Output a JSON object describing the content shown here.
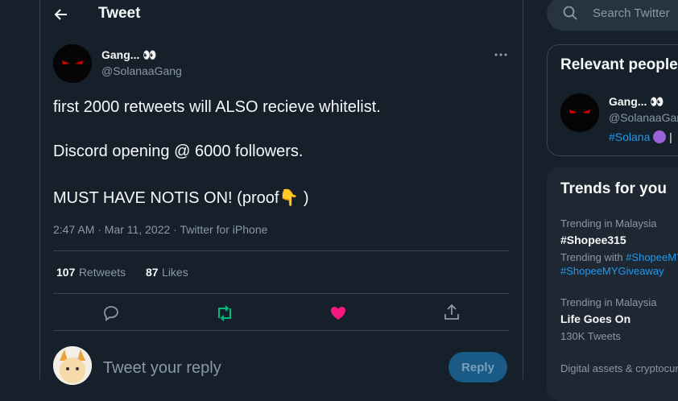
{
  "header": {
    "title": "Tweet"
  },
  "tweet": {
    "author_name": "Gang... 👀",
    "author_handle": "@SolanaaGang",
    "lines": [
      "first 2000 retweets will ALSO recieve whitelist.",
      "Discord opening @ 6000 followers.",
      "MUST HAVE NOTIS ON! (proof👇 )"
    ],
    "meta": "2:47 AM · Mar 11, 2022 · Twitter for iPhone",
    "retweets_count": "107",
    "retweets_label": "Retweets",
    "likes_count": "87",
    "likes_label": "Likes"
  },
  "reply": {
    "placeholder": "Tweet your reply",
    "button": "Reply"
  },
  "search": {
    "placeholder": "Search Twitter"
  },
  "relevant": {
    "title": "Relevant people",
    "name": "Gang... 👀",
    "handle": "@SolanaaGang",
    "bio": "#Solana"
  },
  "trends": {
    "title": "Trends for you",
    "items": [
      {
        "context": "Trending in Malaysia",
        "name": "#Shopee315",
        "with_label": "Trending with",
        "with_tags": "#ShopeeMY",
        "with_tags2": "#ShopeeMYGiveaway"
      },
      {
        "context": "Trending in Malaysia",
        "name": "Life Goes On",
        "count": "130K Tweets"
      },
      {
        "context": "Digital assets & cryptocurrency"
      }
    ]
  },
  "colors": {
    "background": "#15202b",
    "accent": "#1d9bf0",
    "retweet": "#00ba7c",
    "like": "#f91880"
  }
}
